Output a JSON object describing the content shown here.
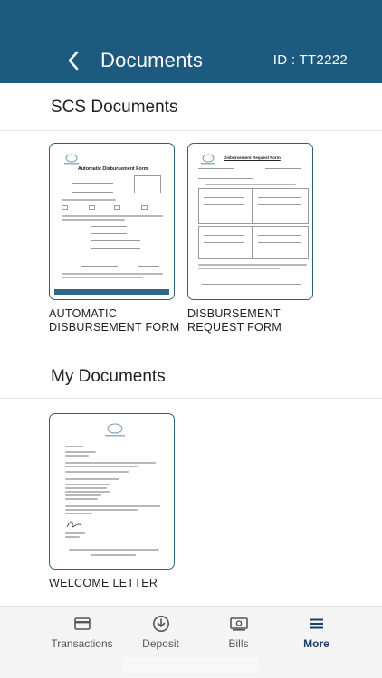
{
  "header": {
    "title": "Documents",
    "id_label": "ID : TT2222",
    "back_icon": "chevron-left-icon"
  },
  "sections": {
    "scs": {
      "title": "SCS Documents",
      "documents": [
        {
          "label": "AUTOMATIC DISBURSEMENT FORM",
          "thumb_title": "Automatic Disbursement Form"
        },
        {
          "label": "DISBURSEMENT REQUEST FORM",
          "thumb_title": "Disbursement Request Form"
        }
      ]
    },
    "mine": {
      "title": "My Documents",
      "documents": [
        {
          "label": "WELCOME LETTER",
          "thumb_title": "Welcome Letter"
        }
      ]
    }
  },
  "tabs": [
    {
      "label": "Transactions",
      "icon": "credit-card-icon",
      "active": false
    },
    {
      "label": "Deposit",
      "icon": "download-circle-icon",
      "active": false
    },
    {
      "label": "Bills",
      "icon": "bill-icon",
      "active": false
    },
    {
      "label": "More",
      "icon": "menu-icon",
      "active": true
    }
  ],
  "colors": {
    "header_bg": "#1d5a80",
    "card_border": "#2f5f78",
    "active_tab": "#1d3f66"
  }
}
